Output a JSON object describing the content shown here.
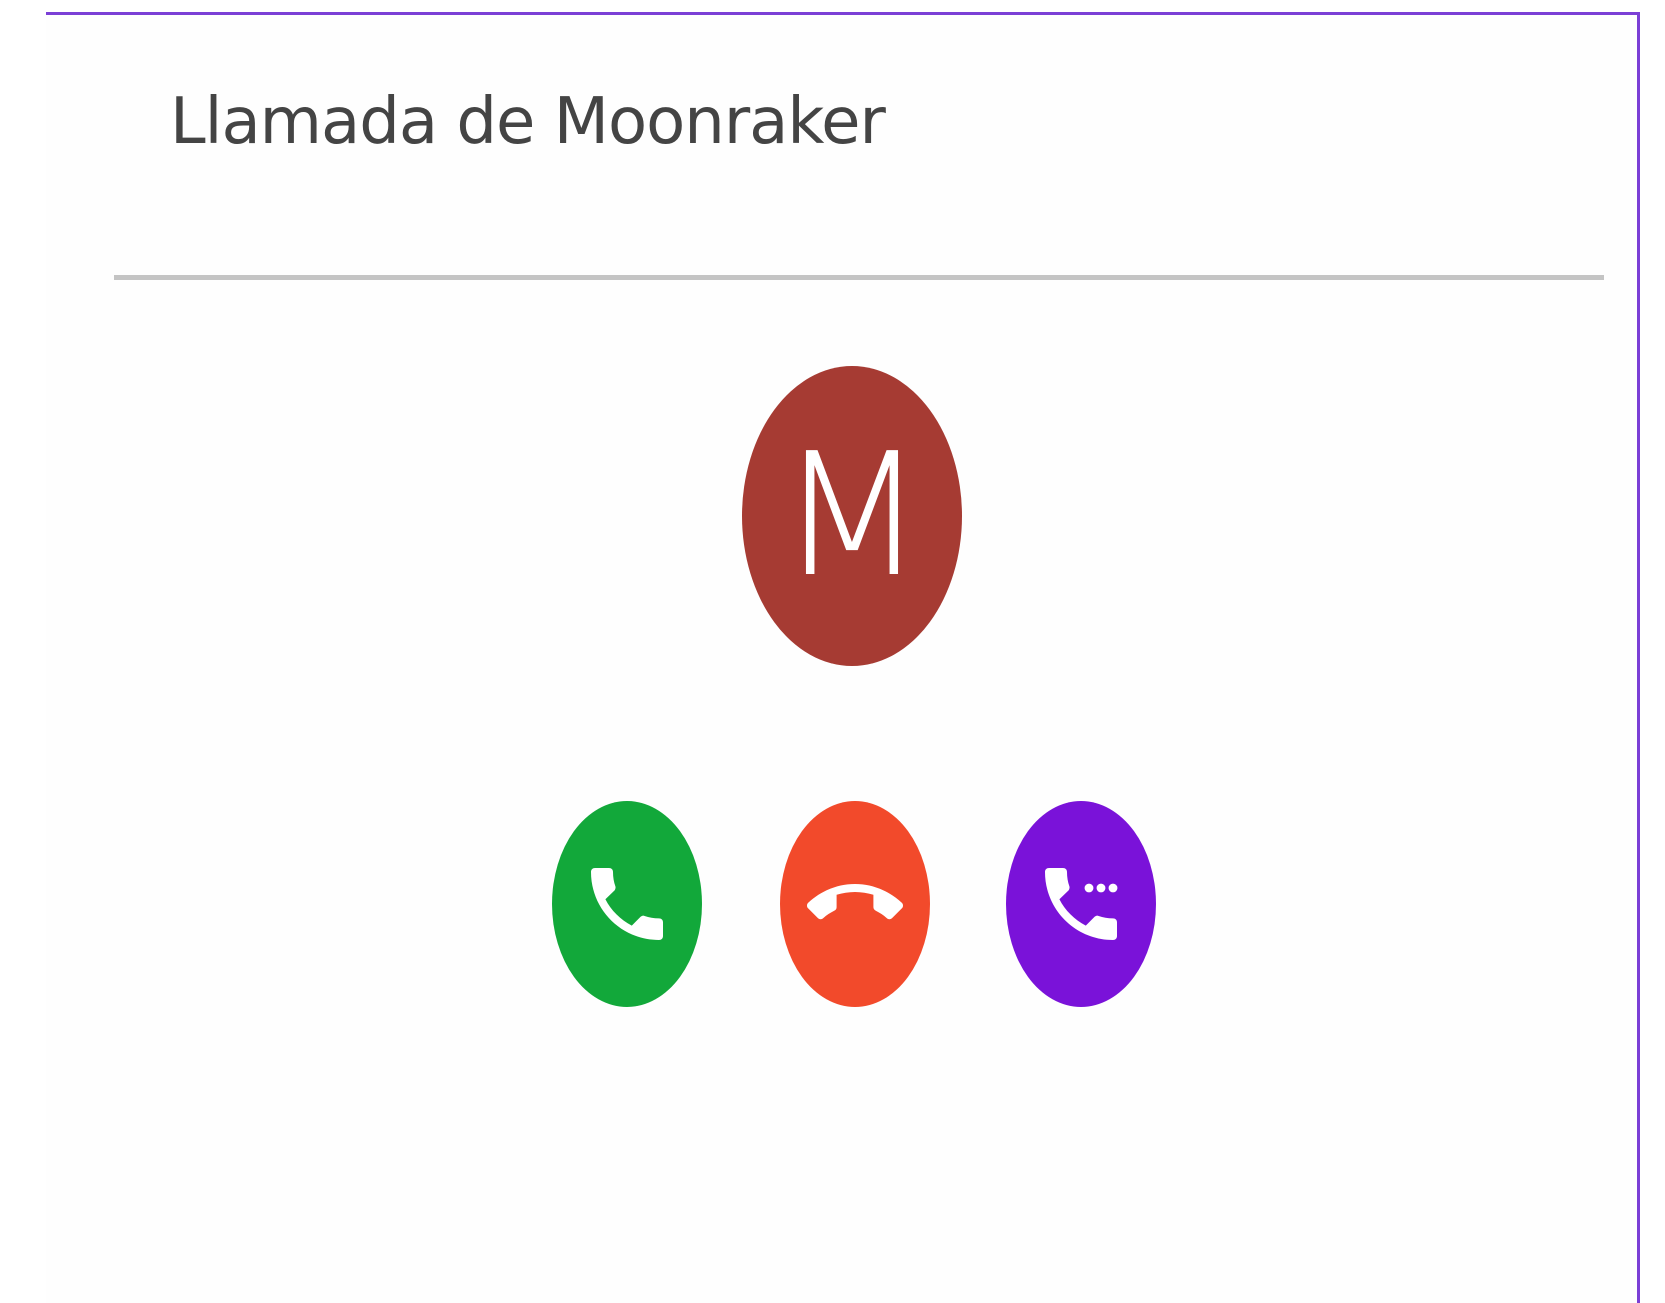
{
  "call": {
    "title": "Llamada de Moonraker",
    "caller_initial": "M"
  },
  "colors": {
    "frame_accent": "#7b3fd6",
    "avatar": "#a63b33",
    "accept": "#12a83a",
    "decline": "#f24a2b",
    "message": "#7a12d9"
  },
  "actions": [
    {
      "id": "accept",
      "icon": "phone-icon"
    },
    {
      "id": "decline",
      "icon": "phone-hangup-icon"
    },
    {
      "id": "message",
      "icon": "phone-message-icon"
    }
  ]
}
